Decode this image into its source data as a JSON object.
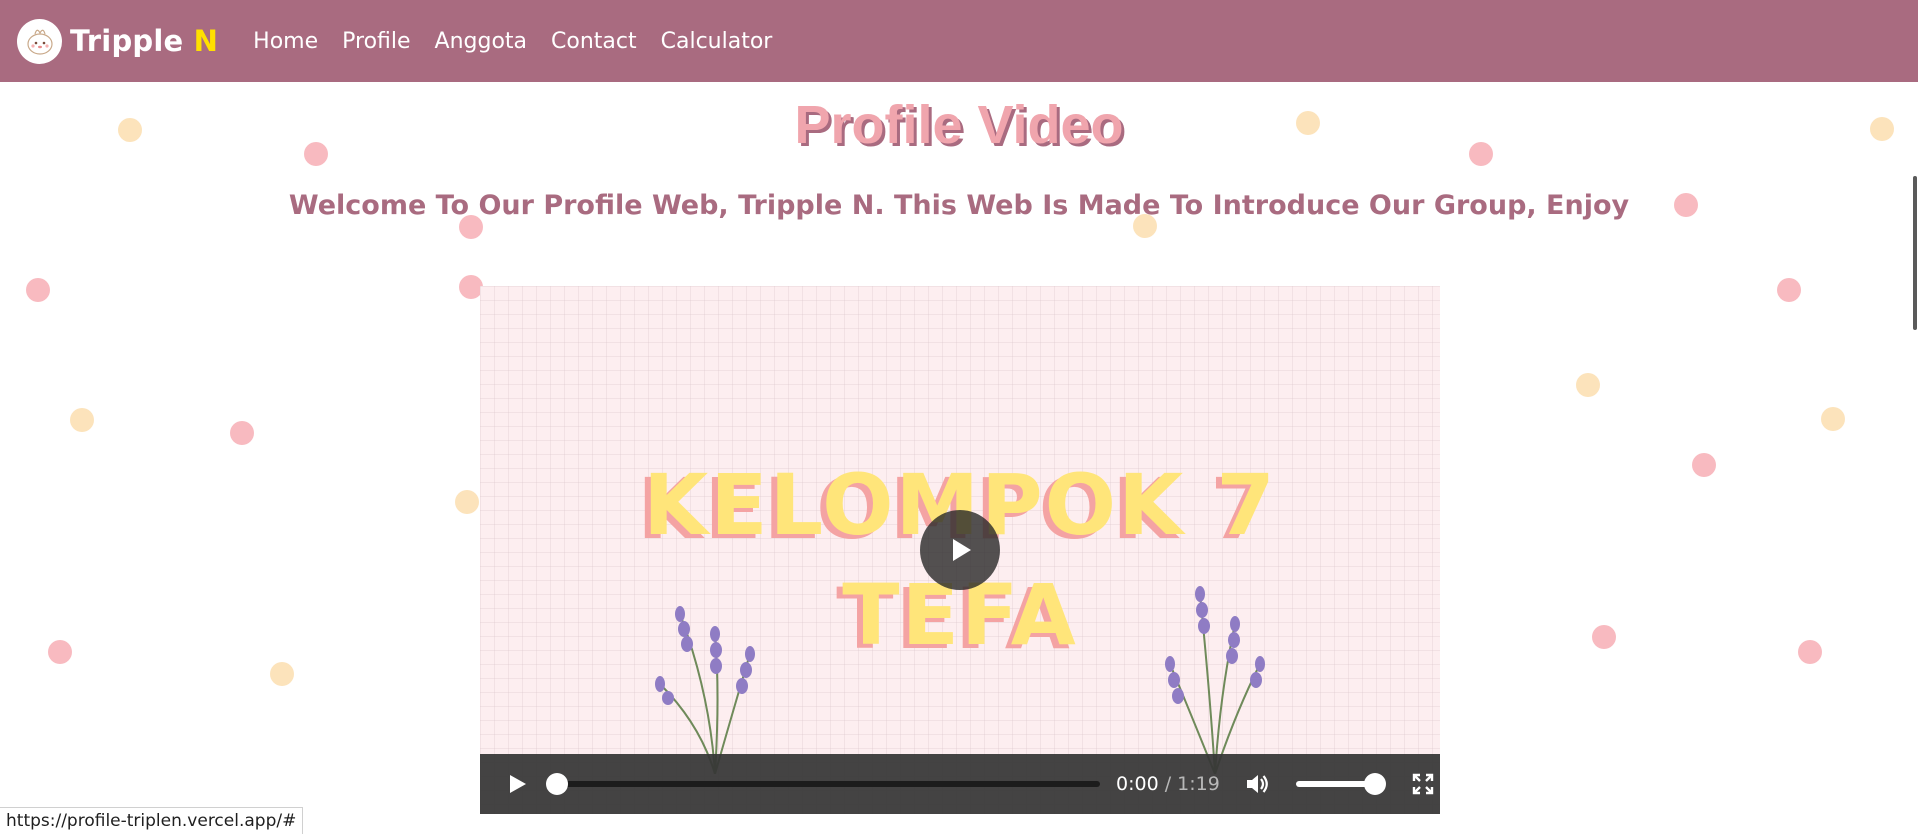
{
  "nav": {
    "brand_main": "Tripple ",
    "brand_accent": "N",
    "links": [
      "Home",
      "Profile",
      "Anggota",
      "Contact",
      "Calculator"
    ]
  },
  "page": {
    "title": "Profile Video",
    "subtitle": "Welcome To Our Profile Web, Tripple N. This Web Is Made To Introduce Our Group, Enjoy"
  },
  "video": {
    "title_line1": "KELOMPOK 7",
    "title_line2": "TEFA",
    "current_time": "0:00",
    "separator": " / ",
    "duration": "1:19",
    "progress_fraction": 0,
    "volume_fraction": 1
  },
  "status": {
    "url": "https://profile-triplen.vercel.app/#"
  },
  "colors": {
    "navbar": "#a96b80",
    "brand_accent": "#ffe000",
    "title": "#f0a5ad",
    "subtitle": "#a96b80",
    "dot_pink": "#f6a3ab",
    "dot_peach": "#fbd9a4"
  },
  "icons": [
    "logo-icon",
    "play-icon",
    "volume-icon",
    "fullscreen-icon"
  ]
}
